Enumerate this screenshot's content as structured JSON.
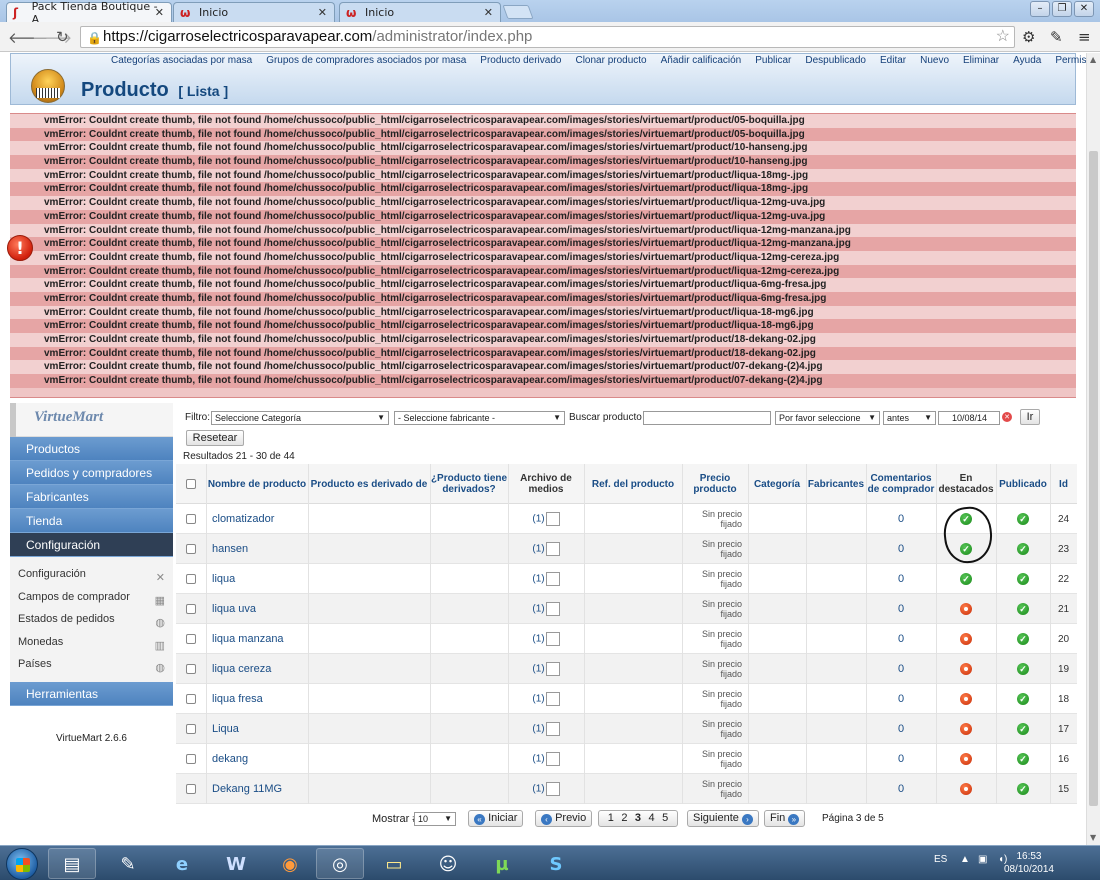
{
  "browser": {
    "tabs": [
      {
        "title": "Pack Tienda Boutique - A",
        "active": true
      },
      {
        "title": "Inicio",
        "active": false
      },
      {
        "title": "Inicio",
        "active": false
      }
    ],
    "url_scheme_host": "https://cigarroselectricosparavapear.com",
    "url_path": "/administrator/index.php"
  },
  "header": {
    "toolbar": [
      "Categorías asociadas por masa",
      "Grupos de compradores asociados por masa",
      "Producto derivado",
      "Clonar producto",
      "Añadir calificación",
      "Publicar",
      "Despublicado",
      "Editar",
      "Nuevo",
      "Eliminar",
      "Ayuda",
      "Permisos"
    ],
    "title": "Producto",
    "subtitle": "[ Lista ]"
  },
  "errors": [
    "vmError: Couldnt create thumb, file not found /home/chussoco/public_html/cigarroselectricosparavapear.com/images/stories/virtuemart/product/05-boquilla.jpg",
    "vmError: Couldnt create thumb, file not found /home/chussoco/public_html/cigarroselectricosparavapear.com/images/stories/virtuemart/product/05-boquilla.jpg",
    "vmError: Couldnt create thumb, file not found /home/chussoco/public_html/cigarroselectricosparavapear.com/images/stories/virtuemart/product/10-hanseng.jpg",
    "vmError: Couldnt create thumb, file not found /home/chussoco/public_html/cigarroselectricosparavapear.com/images/stories/virtuemart/product/10-hanseng.jpg",
    "vmError: Couldnt create thumb, file not found /home/chussoco/public_html/cigarroselectricosparavapear.com/images/stories/virtuemart/product/liqua-18mg-.jpg",
    "vmError: Couldnt create thumb, file not found /home/chussoco/public_html/cigarroselectricosparavapear.com/images/stories/virtuemart/product/liqua-18mg-.jpg",
    "vmError: Couldnt create thumb, file not found /home/chussoco/public_html/cigarroselectricosparavapear.com/images/stories/virtuemart/product/liqua-12mg-uva.jpg",
    "vmError: Couldnt create thumb, file not found /home/chussoco/public_html/cigarroselectricosparavapear.com/images/stories/virtuemart/product/liqua-12mg-uva.jpg",
    "vmError: Couldnt create thumb, file not found /home/chussoco/public_html/cigarroselectricosparavapear.com/images/stories/virtuemart/product/liqua-12mg-manzana.jpg",
    "vmError: Couldnt create thumb, file not found /home/chussoco/public_html/cigarroselectricosparavapear.com/images/stories/virtuemart/product/liqua-12mg-manzana.jpg",
    "vmError: Couldnt create thumb, file not found /home/chussoco/public_html/cigarroselectricosparavapear.com/images/stories/virtuemart/product/liqua-12mg-cereza.jpg",
    "vmError: Couldnt create thumb, file not found /home/chussoco/public_html/cigarroselectricosparavapear.com/images/stories/virtuemart/product/liqua-12mg-cereza.jpg",
    "vmError: Couldnt create thumb, file not found /home/chussoco/public_html/cigarroselectricosparavapear.com/images/stories/virtuemart/product/liqua-6mg-fresa.jpg",
    "vmError: Couldnt create thumb, file not found /home/chussoco/public_html/cigarroselectricosparavapear.com/images/stories/virtuemart/product/liqua-6mg-fresa.jpg",
    "vmError: Couldnt create thumb, file not found /home/chussoco/public_html/cigarroselectricosparavapear.com/images/stories/virtuemart/product/liqua-18-mg6.jpg",
    "vmError: Couldnt create thumb, file not found /home/chussoco/public_html/cigarroselectricosparavapear.com/images/stories/virtuemart/product/liqua-18-mg6.jpg",
    "vmError: Couldnt create thumb, file not found /home/chussoco/public_html/cigarroselectricosparavapear.com/images/stories/virtuemart/product/18-dekang-02.jpg",
    "vmError: Couldnt create thumb, file not found /home/chussoco/public_html/cigarroselectricosparavapear.com/images/stories/virtuemart/product/18-dekang-02.jpg",
    "vmError: Couldnt create thumb, file not found /home/chussoco/public_html/cigarroselectricosparavapear.com/images/stories/virtuemart/product/07-dekang-(2)4.jpg",
    "vmError: Couldnt create thumb, file not found /home/chussoco/public_html/cigarroselectricosparavapear.com/images/stories/virtuemart/product/07-dekang-(2)4.jpg"
  ],
  "sidebar": {
    "logo": "VirtueMart",
    "menu": [
      "Productos",
      "Pedidos y compradores",
      "Fabricantes",
      "Tienda",
      "Configuración"
    ],
    "active_menu": "Configuración",
    "submenu": [
      {
        "label": "Configuración",
        "icon": "tools-icon"
      },
      {
        "label": "Campos de comprador",
        "icon": "fields-icon"
      },
      {
        "label": "Estados de pedidos",
        "icon": "status-icon"
      },
      {
        "label": "Monedas",
        "icon": "coins-icon"
      },
      {
        "label": "Países",
        "icon": "globe-icon"
      }
    ],
    "tools": "Herramientas",
    "version": "VirtueMart 2.6.6"
  },
  "filters": {
    "label": "Filtro:",
    "category": "Seleccione Categoría",
    "manufacturer": "- Seleccione fabricante -",
    "search_label": "Buscar producto",
    "search_value": "",
    "date_option": "Por favor seleccione",
    "before": "antes",
    "date": "10/08/14",
    "go": "Ir",
    "reset": "Resetear",
    "results": "Resultados 21 - 30 de 44"
  },
  "table": {
    "headers": [
      "Nombre de producto",
      "Producto es derivado de",
      "¿Producto tiene derivados?",
      "Archivo de medios",
      "Ref. del producto",
      "Precio producto",
      "Categoría",
      "Fabricantes",
      "Comentarios de comprador",
      "En destacados",
      "Publicado",
      "Id"
    ],
    "price_text": "Sin precio fijado",
    "rows": [
      {
        "name": "clomatizador",
        "media": "(1)",
        "reviews": "0",
        "featured": true,
        "published": true,
        "id": "24"
      },
      {
        "name": "hansen",
        "media": "(1)",
        "reviews": "0",
        "featured": true,
        "published": true,
        "id": "23"
      },
      {
        "name": "liqua",
        "media": "(1)",
        "reviews": "0",
        "featured": true,
        "published": true,
        "id": "22"
      },
      {
        "name": "liqua uva",
        "media": "(1)",
        "reviews": "0",
        "featured": false,
        "published": true,
        "id": "21"
      },
      {
        "name": "liqua manzana",
        "media": "(1)",
        "reviews": "0",
        "featured": false,
        "published": true,
        "id": "20"
      },
      {
        "name": "liqua cereza",
        "media": "(1)",
        "reviews": "0",
        "featured": false,
        "published": true,
        "id": "19"
      },
      {
        "name": "liqua fresa",
        "media": "(1)",
        "reviews": "0",
        "featured": false,
        "published": true,
        "id": "18"
      },
      {
        "name": "Liqua",
        "media": "(1)",
        "reviews": "0",
        "featured": false,
        "published": true,
        "id": "17"
      },
      {
        "name": "dekang",
        "media": "(1)",
        "reviews": "0",
        "featured": false,
        "published": true,
        "id": "16"
      },
      {
        "name": "Dekang 11MG",
        "media": "(1)",
        "reviews": "0",
        "featured": false,
        "published": true,
        "id": "15"
      }
    ]
  },
  "pagination": {
    "show_label": "Mostrar #",
    "show_value": "10",
    "first": "Iniciar",
    "prev": "Previo",
    "pages": [
      "1",
      "2",
      "3",
      "4",
      "5"
    ],
    "current_page": "3",
    "next": "Siguiente",
    "last": "Fin",
    "page_info": "Página 3 de 5"
  },
  "taskbar": {
    "language": "ES",
    "time": "16:53",
    "date": "08/10/2014"
  }
}
